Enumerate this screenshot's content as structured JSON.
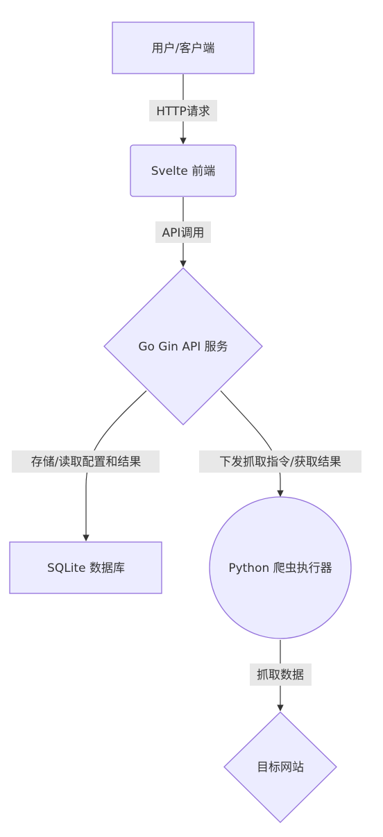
{
  "colors": {
    "node_fill": "#ececff",
    "node_stroke": "#9370db",
    "edge_color": "#333333",
    "edge_label_bg": "#e8e8e8",
    "text_color": "#333333"
  },
  "nodes": {
    "user_client": "用户/客户端",
    "svelte_frontend": "Svelte 前端",
    "go_api": "Go Gin API 服务",
    "sqlite_db": "SQLite 数据库",
    "python_crawler": "Python 爬虫执行器",
    "target_site": "目标网站"
  },
  "edges": {
    "http_request": "HTTP请求",
    "api_call": "API调用",
    "store_read": "存储/读取配置和结果",
    "dispatch_fetch": "下发抓取指令/获取结果",
    "crawl_data": "抓取数据"
  }
}
